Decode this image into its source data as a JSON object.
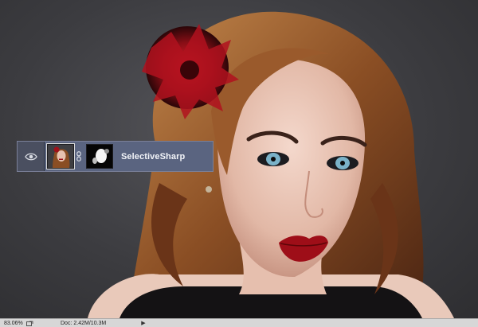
{
  "layers_panel": {
    "layer": {
      "name": "SelectiveSharp",
      "visibility_icon": "eye-icon",
      "link_icon": "chain-link-icon"
    }
  },
  "status_bar": {
    "zoom": "83.06%",
    "doc_label": "Doc:",
    "doc_size": "2.42M/10.3M",
    "menu_arrow": "▶"
  },
  "colors": {
    "layer_highlight": "#5a6480",
    "status_bar_bg": "#d7d7d7",
    "canvas_bg": "#3c3c40"
  }
}
